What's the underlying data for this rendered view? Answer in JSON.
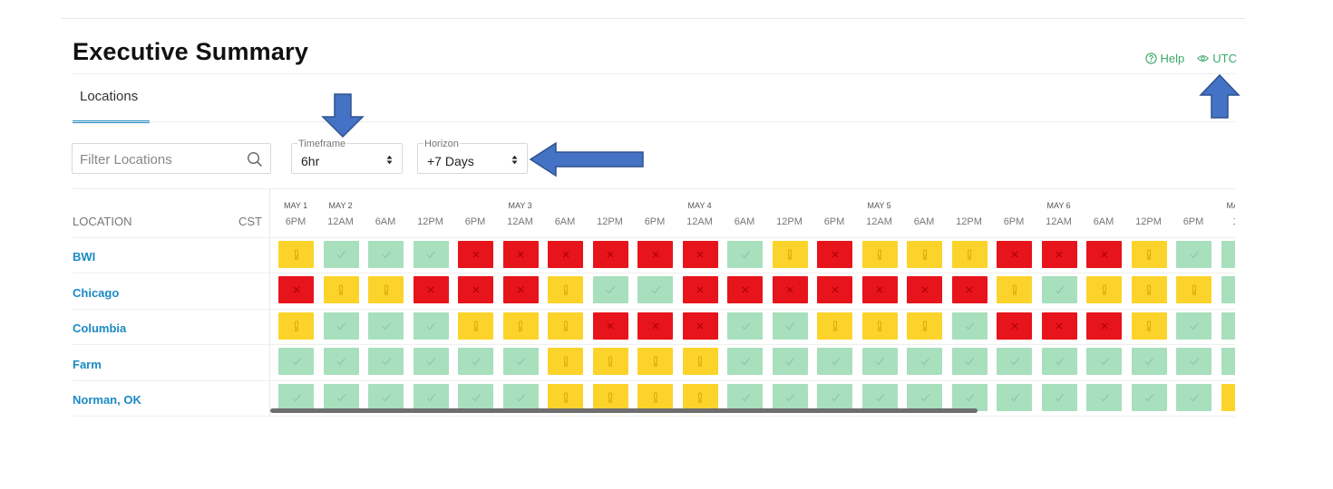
{
  "header": {
    "title": "Executive Summary",
    "help_label": "Help",
    "utc_label": "UTC"
  },
  "tabs": [
    {
      "label": "Locations",
      "active": true
    }
  ],
  "filter": {
    "placeholder": "Filter Locations",
    "value": ""
  },
  "timeframe": {
    "label": "Timeframe",
    "value": "6hr"
  },
  "horizon": {
    "label": "Horizon",
    "value": "+7 Days"
  },
  "grid": {
    "location_header": "LOCATION",
    "timezone": "CST",
    "dates": [
      "MAY 1",
      "MAY 2",
      "MAY 3",
      "MAY 4",
      "MAY 5",
      "MAY 6",
      "MA"
    ],
    "times": [
      "6PM",
      "12AM",
      "6AM",
      "12PM",
      "6PM",
      "12AM",
      "6AM",
      "12PM",
      "6PM",
      "12AM",
      "6AM",
      "12PM",
      "6PM",
      "12AM",
      "6AM",
      "12PM",
      "6PM",
      "12AM",
      "6AM",
      "12PM",
      "6PM",
      "12"
    ],
    "rows": [
      {
        "name": "BWI",
        "status": [
          "warn",
          "ok",
          "ok",
          "ok",
          "bad",
          "bad",
          "bad",
          "bad",
          "bad",
          "bad",
          "ok",
          "warn",
          "bad",
          "warn",
          "warn",
          "warn",
          "bad",
          "bad",
          "bad",
          "warn",
          "ok",
          "ok"
        ]
      },
      {
        "name": "Chicago",
        "status": [
          "bad",
          "warn",
          "warn",
          "bad",
          "bad",
          "bad",
          "warn",
          "ok",
          "ok",
          "bad",
          "bad",
          "bad",
          "bad",
          "bad",
          "bad",
          "bad",
          "warn",
          "ok",
          "warn",
          "warn",
          "warn",
          "ok"
        ]
      },
      {
        "name": "Columbia",
        "status": [
          "warn",
          "ok",
          "ok",
          "ok",
          "warn",
          "warn",
          "warn",
          "bad",
          "bad",
          "bad",
          "ok",
          "ok",
          "warn",
          "warn",
          "warn",
          "ok",
          "bad",
          "bad",
          "bad",
          "warn",
          "ok",
          "ok"
        ]
      },
      {
        "name": "Farm",
        "status": [
          "ok",
          "ok",
          "ok",
          "ok",
          "ok",
          "ok",
          "warn",
          "warn",
          "warn",
          "warn",
          "ok",
          "ok",
          "ok",
          "ok",
          "ok",
          "ok",
          "ok",
          "ok",
          "ok",
          "ok",
          "ok",
          "ok"
        ]
      },
      {
        "name": "Norman, OK",
        "status": [
          "ok",
          "ok",
          "ok",
          "ok",
          "ok",
          "ok",
          "warn",
          "warn",
          "warn",
          "warn",
          "ok",
          "ok",
          "ok",
          "ok",
          "ok",
          "ok",
          "ok",
          "ok",
          "ok",
          "ok",
          "ok",
          "warn"
        ]
      }
    ]
  },
  "icons": {
    "help": "help-circle-icon",
    "utc": "eye-icon",
    "search": "search-icon",
    "ok": "checkmark-icon",
    "warn": "exclamation-icon",
    "bad": "x-icon",
    "annotation": "blue-arrow-icon"
  },
  "colors": {
    "ok": "#a8dfbd",
    "warn": "#fcd32b",
    "bad": "#e8141b",
    "link": "#1a8ac4",
    "accent_green": "#3aa86b",
    "tab_underline": "#1f8dc7",
    "annotation_arrow": "#4472c4"
  }
}
